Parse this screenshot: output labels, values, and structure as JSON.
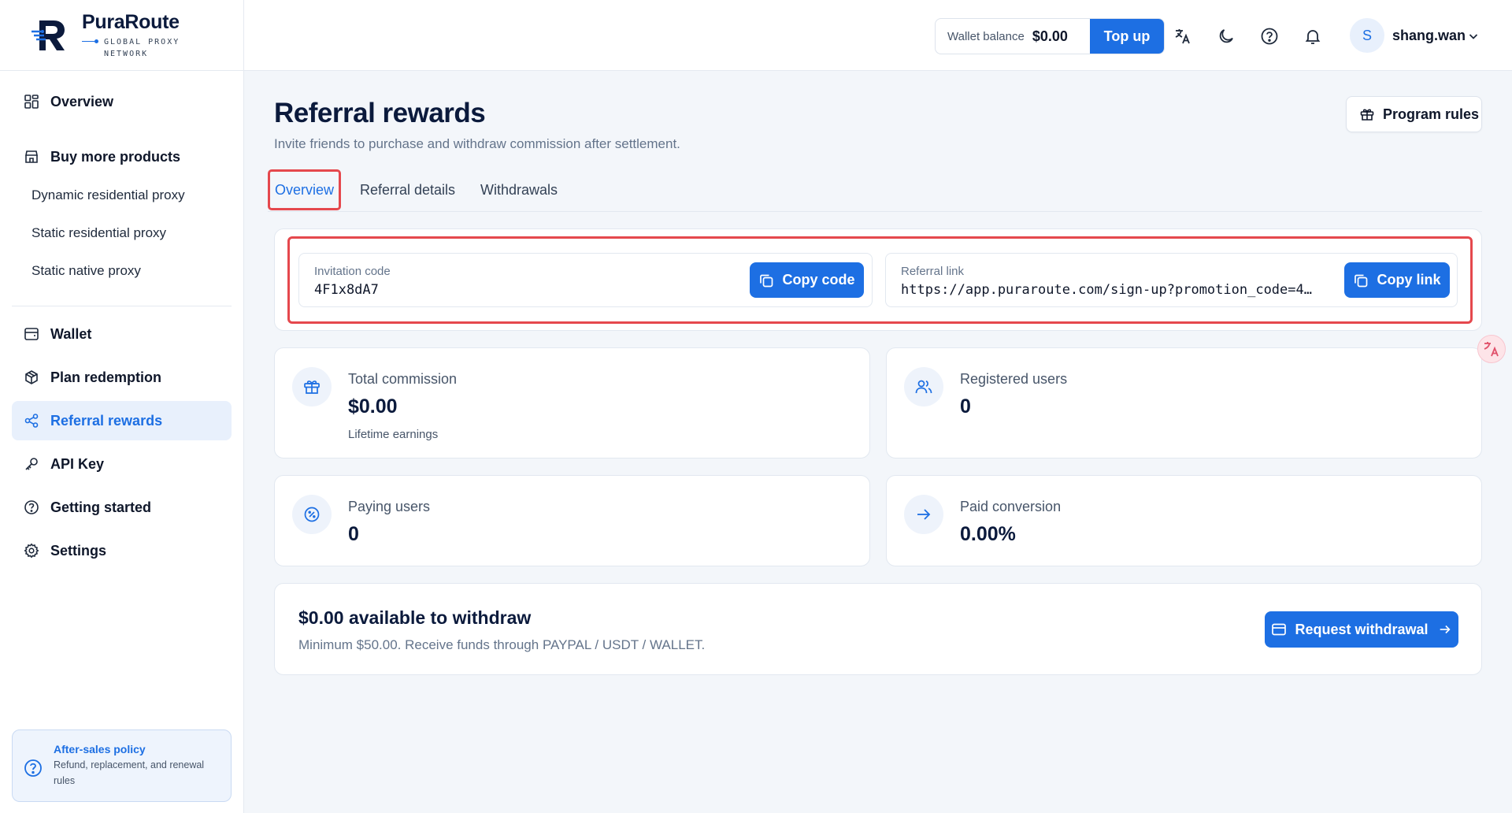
{
  "brand": {
    "name": "PuraRoute",
    "tagline_line1": "GLOBAL PROXY",
    "tagline_line2": "NETWORK"
  },
  "sidebar": {
    "items": [
      {
        "label": "Overview",
        "icon": "dashboard-icon"
      },
      {
        "label": "Buy more products",
        "icon": "store-icon"
      },
      {
        "label": "Dynamic residential proxy"
      },
      {
        "label": "Static residential proxy"
      },
      {
        "label": "Static native proxy"
      },
      {
        "label": "Wallet",
        "icon": "wallet-icon"
      },
      {
        "label": "Plan redemption",
        "icon": "package-icon"
      },
      {
        "label": "Referral rewards",
        "icon": "share-icon",
        "active": true
      },
      {
        "label": "API Key",
        "icon": "key-icon"
      },
      {
        "label": "Getting started",
        "icon": "help-circle-icon"
      },
      {
        "label": "Settings",
        "icon": "gear-icon"
      }
    ],
    "policy": {
      "title": "After-sales policy",
      "description": "Refund, replacement, and renewal rules"
    }
  },
  "header": {
    "wallet_label": "Wallet balance",
    "wallet_amount": "$0.00",
    "topup_label": "Top up",
    "user_initial": "S",
    "username": "shang.wan"
  },
  "page": {
    "title": "Referral rewards",
    "subtitle": "Invite friends to purchase and withdraw commission after settlement.",
    "program_rules_label": "Program rules"
  },
  "tabs": [
    {
      "label": "Overview",
      "active": true
    },
    {
      "label": "Referral details"
    },
    {
      "label": "Withdrawals"
    }
  ],
  "share": {
    "code_label": "Invitation code",
    "code_value": "4F1x8dA7",
    "copy_code_label": "Copy code",
    "link_label": "Referral link",
    "link_value": "https://app.puraroute.com/sign-up?promotion_code=4…",
    "copy_link_label": "Copy link"
  },
  "stats": [
    {
      "label": "Total commission",
      "value": "$0.00",
      "note": "Lifetime earnings",
      "icon": "gift-icon"
    },
    {
      "label": "Registered users",
      "value": "0",
      "icon": "users-icon"
    },
    {
      "label": "Paying users",
      "value": "0",
      "icon": "percent-badge-icon"
    },
    {
      "label": "Paid conversion",
      "value": "0.00%",
      "icon": "arrow-right-icon"
    }
  ],
  "withdraw": {
    "title": "$0.00 available to withdraw",
    "subtitle": "Minimum $50.00. Receive funds through PAYPAL / USDT / WALLET.",
    "button_label": "Request withdrawal"
  },
  "colors": {
    "accent": "#1d6fe3",
    "highlight": "#e5484d",
    "background": "#f3f6fa"
  }
}
